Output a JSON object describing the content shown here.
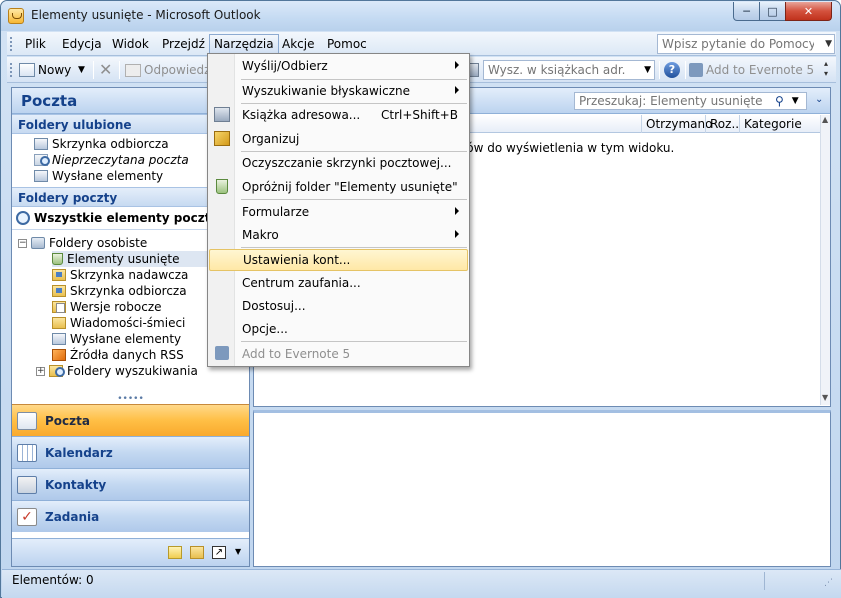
{
  "window": {
    "title": "Elementy usunięte - Microsoft Outlook",
    "minimize": "─",
    "maximize": "□",
    "close": "✕"
  },
  "menubar": {
    "items": [
      {
        "label": "Plik"
      },
      {
        "label": "Edycja"
      },
      {
        "label": "Widok"
      },
      {
        "label": "Przejdź"
      },
      {
        "label": "Narzędzia"
      },
      {
        "label": "Akcje"
      },
      {
        "label": "Pomoc"
      }
    ],
    "help_placeholder": "Wpisz pytanie do Pomocy"
  },
  "toolbar": {
    "new_label": "Nowy",
    "reply_label": "Odpowiedz",
    "address_search_placeholder": "Wysz. w książkach adr.",
    "evernote_label": "Add to Evernote 5"
  },
  "nav": {
    "title": "Poczta",
    "favorites_header": "Foldery ulubione",
    "favorites": [
      {
        "label": "Skrzynka odbiorcza"
      },
      {
        "label": "Nieprzeczytana poczta"
      },
      {
        "label": "Wysłane elementy"
      }
    ],
    "mail_folders_header": "Foldery poczty",
    "all_items": "Wszystkie elementy poczty",
    "personal_folders": "Foldery osobiste",
    "folders": [
      {
        "label": "Elementy usunięte"
      },
      {
        "label": "Skrzynka nadawcza"
      },
      {
        "label": "Skrzynka odbiorcza"
      },
      {
        "label": "Wersje robocze"
      },
      {
        "label": "Wiadomości-śmieci"
      },
      {
        "label": "Wysłane elementy"
      },
      {
        "label": "Źródła danych RSS"
      },
      {
        "label": "Foldery wyszukiwania"
      }
    ],
    "buttons": [
      {
        "label": "Poczta"
      },
      {
        "label": "Kalendarz"
      },
      {
        "label": "Kontakty"
      },
      {
        "label": "Zadania"
      }
    ]
  },
  "content": {
    "search_placeholder": "Przeszukaj: Elementy usunięte",
    "columns": [
      "Otrzymano",
      "Roz...",
      "Kategorie"
    ],
    "empty_message": "ntów do wyświetlenia w tym widoku."
  },
  "tools_menu": {
    "items": [
      {
        "label": "Wyślij/Odbierz"
      },
      {
        "label": "Wyszukiwanie błyskawiczne"
      },
      {
        "label": "Książka adresowa...",
        "shortcut": "Ctrl+Shift+B"
      },
      {
        "label": "Organizuj"
      },
      {
        "label": "Oczyszczanie skrzynki pocztowej..."
      },
      {
        "label": "Opróżnij folder \"Elementy usunięte\""
      },
      {
        "label": "Formularze"
      },
      {
        "label": "Makro"
      },
      {
        "label": "Ustawienia kont..."
      },
      {
        "label": "Centrum zaufania..."
      },
      {
        "label": "Dostosuj..."
      },
      {
        "label": "Opcje..."
      },
      {
        "label": "Add to Evernote 5"
      }
    ]
  },
  "status": {
    "items_count": "Elementów: 0"
  },
  "colors": {
    "accent": "#15428b",
    "active_nav": "#ffbf45",
    "menu_highlight": "#ffe8a6"
  }
}
